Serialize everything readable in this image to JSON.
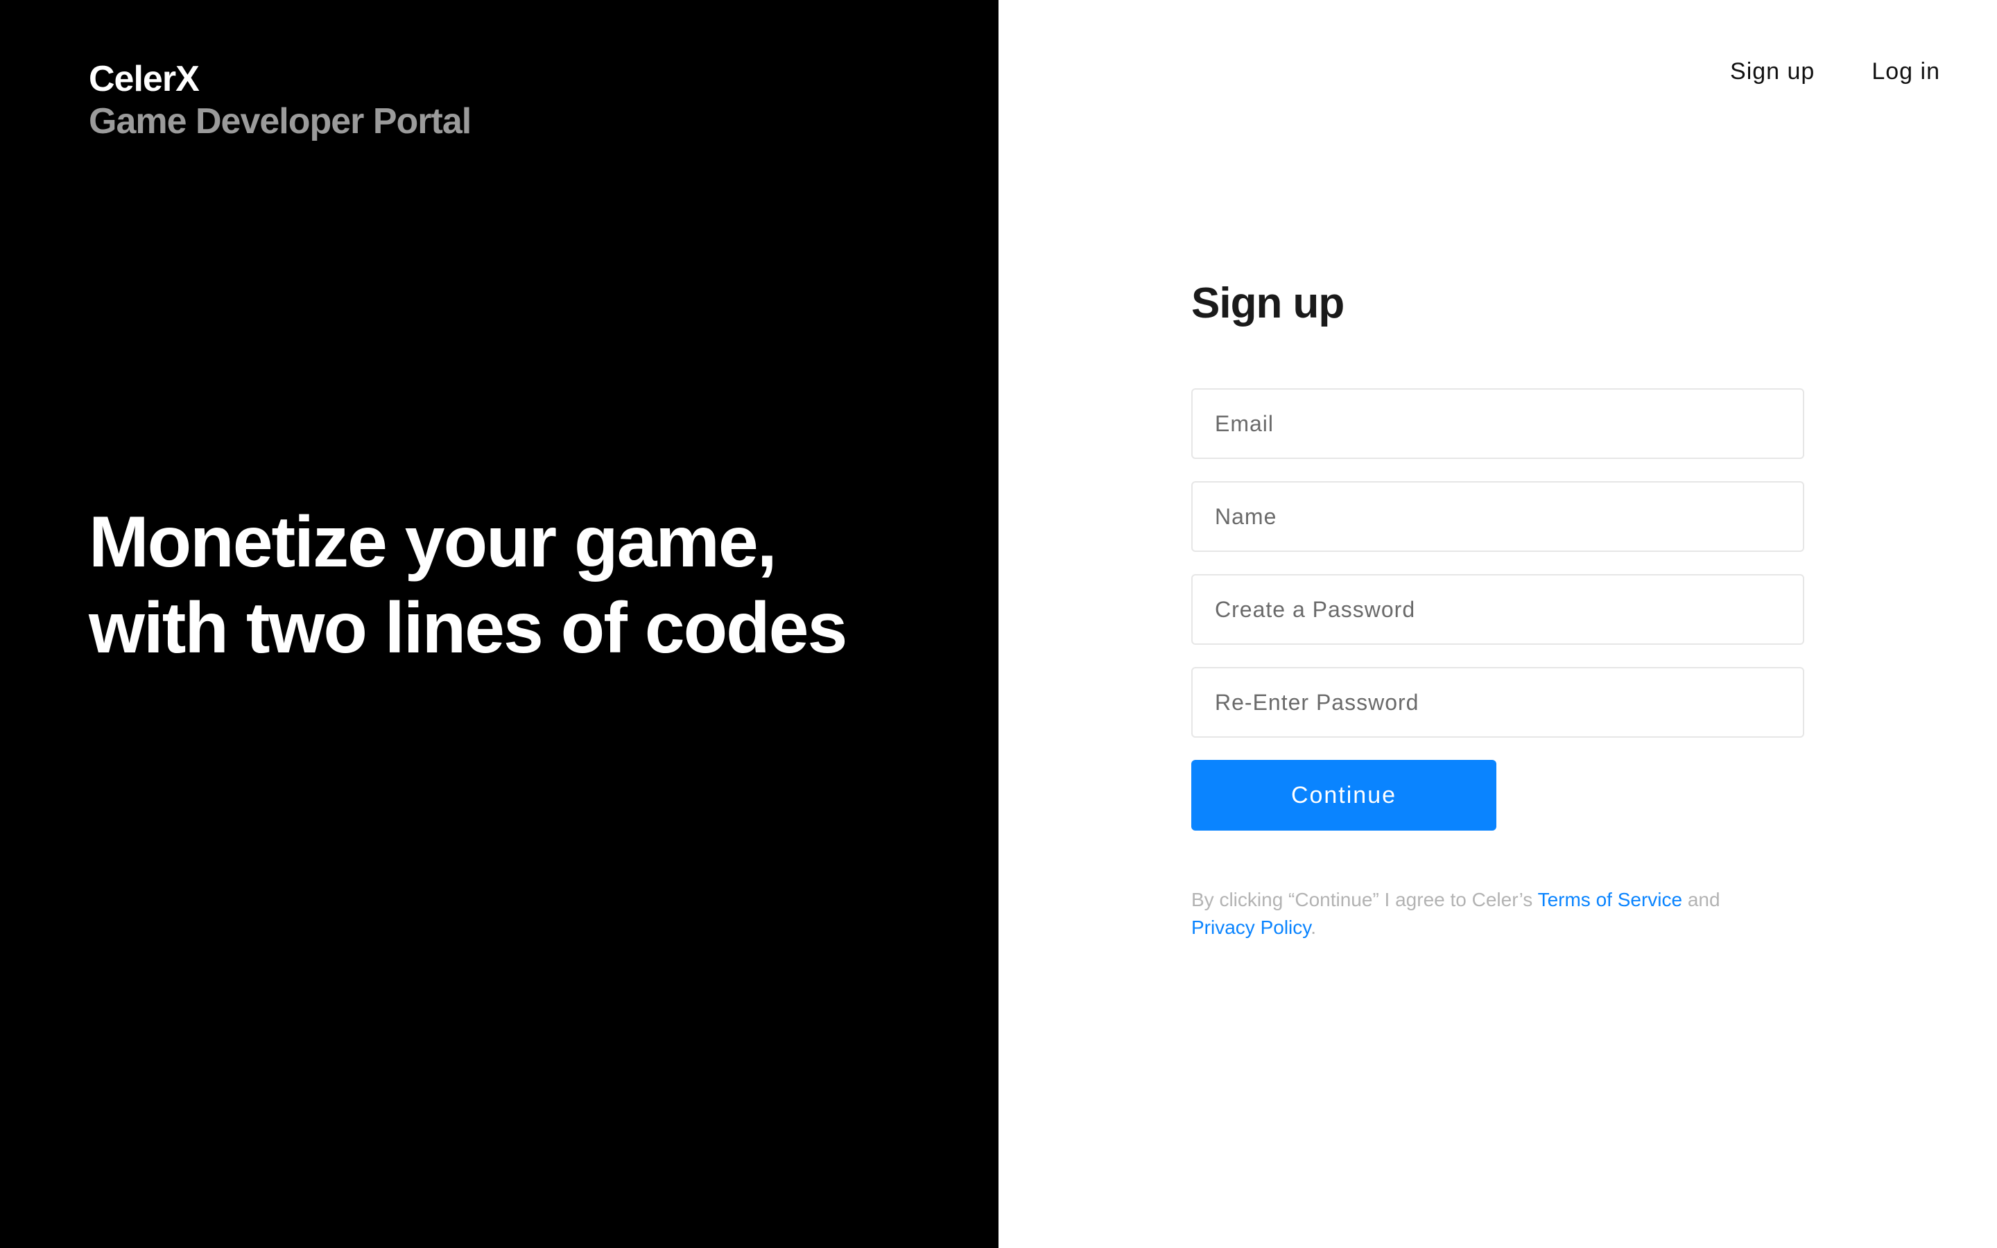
{
  "brand": {
    "name": "CelerX",
    "subtitle": "Game Developer Portal"
  },
  "hero": {
    "line1": "Monetize your game,",
    "line2": "with two lines of codes"
  },
  "nav": {
    "signup_label": "Sign up",
    "login_label": "Log in"
  },
  "form": {
    "title": "Sign up",
    "email_placeholder": "Email",
    "name_placeholder": "Name",
    "password_placeholder": "Create a Password",
    "reenter_placeholder": "Re-Enter Password",
    "continue_label": "Continue"
  },
  "legal": {
    "prefix": "By clicking “Continue” I agree to Celer’s ",
    "terms_label": "Terms of Service",
    "middle": " and ",
    "privacy_label": "Privacy Policy",
    "suffix": "."
  },
  "colors": {
    "left_background": "#000000",
    "accent": "#0a84ff",
    "brand_subtitle": "#9b9b9b"
  }
}
